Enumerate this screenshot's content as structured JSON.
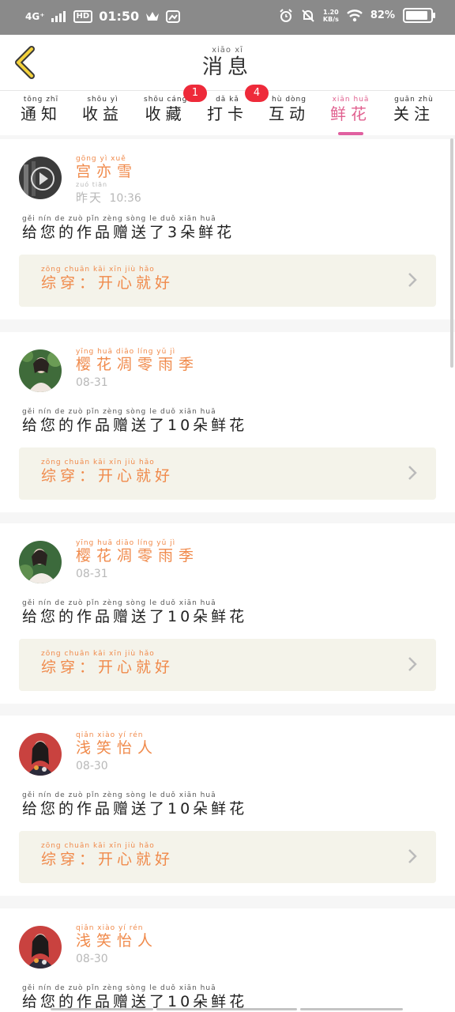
{
  "status_bar": {
    "network": "4G⁺",
    "hd": "HD",
    "time": "01:50",
    "net_speed": "1.20\nKB/s",
    "battery": "82%"
  },
  "header": {
    "title_pinyin": "xiāo  xī",
    "title": "消息"
  },
  "tabs": [
    {
      "pinyin": "tōng  zhī",
      "label": "通知"
    },
    {
      "pinyin": "shōu  yì",
      "label": "收益"
    },
    {
      "pinyin": "shōu  cáng",
      "label": "收藏",
      "badge": "1"
    },
    {
      "pinyin": "dǎ  kǎ",
      "label": "打卡",
      "badge": "4"
    },
    {
      "pinyin": "hù  dòng",
      "label": "互动"
    },
    {
      "pinyin": "xiān  huā",
      "label": "鲜花",
      "active": true
    },
    {
      "pinyin": "guān  zhù",
      "label": "关注"
    }
  ],
  "items": [
    {
      "name_pinyin": "gōng  yì  xuě",
      "name": "宫亦雪",
      "time_pinyin": "zuó tiān",
      "time_word": "昨天",
      "time": "10:36",
      "msg_pinyin": "gěi  nín  de  zuò  pǐn  zèng  sòng  le  duǒ  xiān  huā",
      "msg": "给您的作品赠送了3朵鲜花",
      "work_pinyin": "zōng  chuān   kāi  xīn  jiù  hǎo",
      "work": "综穿：开心就好"
    },
    {
      "name_pinyin": "yīng  huā  diāo  líng  yǔ  jì",
      "name": "樱花凋零雨季",
      "time": "08-31",
      "msg_pinyin": "gěi  nín  de  zuò  pǐn  zèng  sòng  le  duǒ  xiān  huā",
      "msg": "给您的作品赠送了10朵鲜花",
      "work_pinyin": "zōng  chuān   kāi  xīn  jiù  hǎo",
      "work": "综穿：开心就好"
    },
    {
      "name_pinyin": "yīng  huā  diāo  líng  yǔ  jì",
      "name": "樱花凋零雨季",
      "time": "08-31",
      "msg_pinyin": "gěi  nín  de  zuò  pǐn  zèng  sòng  le  duǒ  xiān  huā",
      "msg": "给您的作品赠送了10朵鲜花",
      "work_pinyin": "zōng  chuān   kāi  xīn  jiù  hǎo",
      "work": "综穿：开心就好"
    },
    {
      "name_pinyin": "qiǎn  xiào  yí  rén",
      "name": "浅笑怡人",
      "time": "08-30",
      "msg_pinyin": "gěi  nín  de  zuò  pǐn  zèng  sòng  le  duǒ  xiān  huā",
      "msg": "给您的作品赠送了10朵鲜花",
      "work_pinyin": "zōng  chuān   kāi  xīn  jiù  hǎo",
      "work": "综穿：开心就好"
    },
    {
      "name_pinyin": "qiǎn  xiào  yí  rén",
      "name": "浅笑怡人",
      "time": "08-30",
      "msg_pinyin": "gěi  nín  de  zuò  pǐn  zèng  sòng  le  duǒ  xiān  huā",
      "msg": "给您的作品赠送了10朵鲜花"
    }
  ]
}
